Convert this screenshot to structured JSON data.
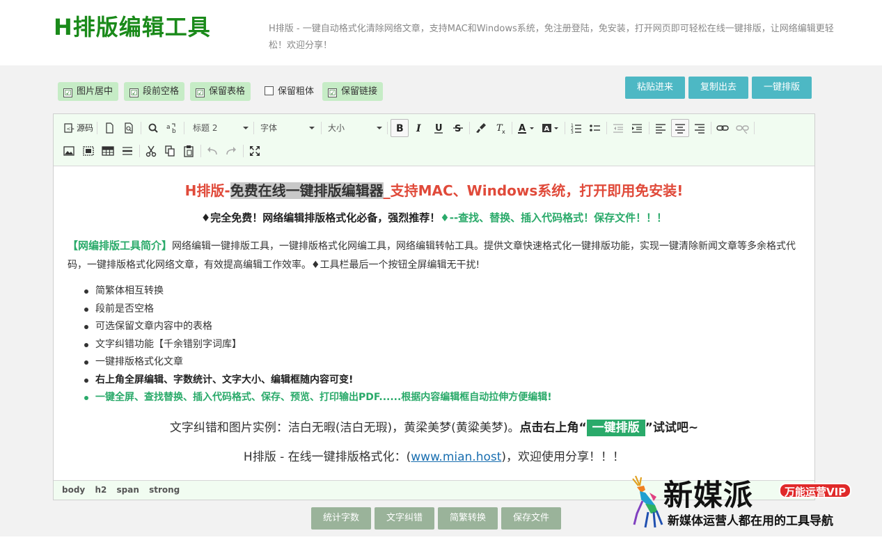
{
  "header": {
    "site_title": "H排版编辑工具",
    "description": "H排版 - 一键自动格式化清除网络文章，支持MAC和Windows系统，免注册登陆，免安装，打开网页即可轻松在线一键排版，让网络编辑更轻松！欢迎分享！"
  },
  "options": [
    {
      "label": "图片居中",
      "checked": true
    },
    {
      "label": "段前空格",
      "checked": true
    },
    {
      "label": "保留表格",
      "checked": true
    },
    {
      "label": "保留粗体",
      "checked": false
    },
    {
      "label": "保留链接",
      "checked": true
    }
  ],
  "actions": {
    "paste": "粘贴进来",
    "copy": "复制出去",
    "format": "一键排版"
  },
  "toolbar": {
    "source": "源码",
    "heading_select": "标题 2",
    "font_select": "字体",
    "size_select": "大小",
    "check_mark": "☑"
  },
  "content": {
    "title_part1": "H排版-",
    "title_highlight": "免费在线一键排版编辑器",
    "title_part2": "_支持MAC、Windows系统，打开即用免安装!",
    "subtitle_part1": "♦完全免费！网络编辑排版格式化必备，强烈推荐！",
    "subtitle_part2": "♦--查找、替换、插入代码格式！保存文件！！！",
    "intro_tag": "【网编排版工具简介】",
    "intro_text": "网络编辑一键排版工具，一键排版格式化网编工具，网络编辑转帖工具。提供文章快速格式化一键排版功能，实现一键清除新闻文章等多余格式代码，一键排版格式化网络文章，有效提高编辑工作效率。♦工具栏最后一个按钮全屏编辑无干扰!",
    "list": [
      {
        "text": "简繁体相互转换",
        "style": "normal"
      },
      {
        "text": "段前是否空格",
        "style": "normal"
      },
      {
        "text": "可选保留文章内容中的表格",
        "style": "normal"
      },
      {
        "text": "文字纠错功能【千余错别字词库】",
        "style": "normal"
      },
      {
        "text": "一键排版格式化文章",
        "style": "normal"
      },
      {
        "text": "右上角全屏编辑、字数统计、文字大小、编辑框随内容可变!",
        "style": "bold"
      },
      {
        "text": "一键全屏、查找替换、插入代码格式、保存、预览、打印输出PDF......根据内容编辑框自动拉伸方便编辑!",
        "style": "green"
      }
    ],
    "example_text": "文字纠错和图片实例：洁白无暇(洁白无瑕)，黄梁美梦(黄粱美梦)。",
    "example_bold": "点击右上角“",
    "example_button": "一键排版",
    "example_end": "”试试吧~",
    "share_prefix": "H排版 - 在线一键排版格式化：(",
    "share_link": "www.mian.host",
    "share_suffix": ")，欢迎使用分享！！！"
  },
  "statusbar": [
    "body",
    "h2",
    "span",
    "strong"
  ],
  "bottom_buttons": {
    "count": "统计字数",
    "correct": "文字纠错",
    "convert": "简繁转换",
    "save": "保存文件"
  },
  "watermark": {
    "brand": "新媒派",
    "vip": "万能运营VIP",
    "slogan": "新媒体运营人都在用的工具导航"
  },
  "colors": {
    "title_green": "#1a8a1a",
    "action_teal": "#4db8c4",
    "bottom_gray_green": "#9ab39a",
    "content_red": "#e04a3a",
    "content_green": "#2aaa6a"
  }
}
